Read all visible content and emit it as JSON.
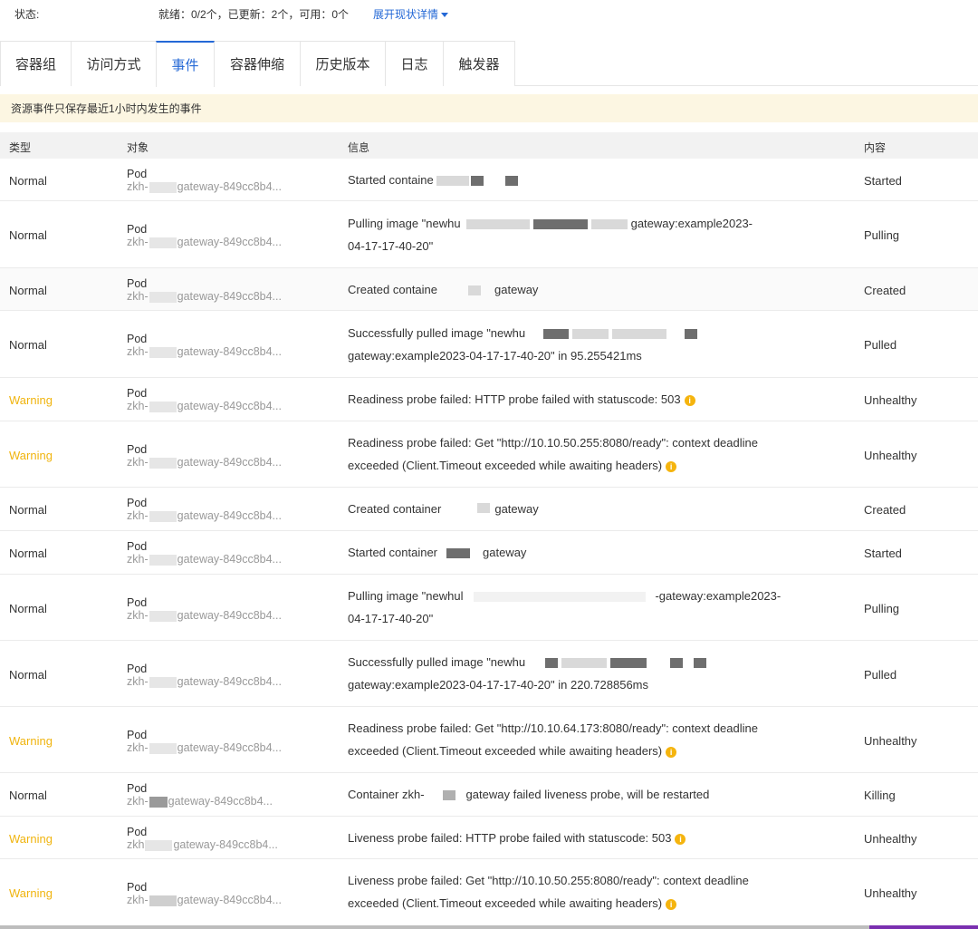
{
  "status": {
    "label": "状态:",
    "value": "就绪：0/2个，已更新：2个，可用：0个",
    "link": "展开现状详情"
  },
  "tabs": [
    {
      "label": "容器组",
      "active": false
    },
    {
      "label": "访问方式",
      "active": false
    },
    {
      "label": "事件",
      "active": true
    },
    {
      "label": "容器伸缩",
      "active": false
    },
    {
      "label": "历史版本",
      "active": false
    },
    {
      "label": "日志",
      "active": false
    },
    {
      "label": "触发器",
      "active": false
    }
  ],
  "notice": "资源事件只保存最近1小时内发生的事件",
  "table": {
    "headers": {
      "type": "类型",
      "object": "对象",
      "message": "信息",
      "reason": "内容"
    },
    "rows": [
      {
        "type": "Normal",
        "kind": "Pod",
        "name_prefix": "zkh-",
        "name_suffix": "gateway-849cc8b4...",
        "msg1": "Started containe",
        "msg2": "",
        "reason": "Started"
      },
      {
        "type": "Normal",
        "kind": "Pod",
        "name_prefix": "zkh-",
        "name_suffix": "gateway-849cc8b4...",
        "msg1": "Pulling image \"newhu",
        "msg1b": "gateway:example2023-",
        "msg2": "04-17-17-40-20\"",
        "reason": "Pulling"
      },
      {
        "type": "Normal",
        "kind": "Pod",
        "name_prefix": "zkh-",
        "name_suffix": "gateway-849cc8b4...",
        "msg1": "Created containe",
        "msg1b": "gateway",
        "msg2": "",
        "reason": "Created"
      },
      {
        "type": "Normal",
        "kind": "Pod",
        "name_prefix": "zkh-",
        "name_suffix": "gateway-849cc8b4...",
        "msg1": "Successfully pulled image \"newhu",
        "msg2": "gateway:example2023-04-17-17-40-20\" in 95.255421ms",
        "reason": "Pulled"
      },
      {
        "type": "Warning",
        "kind": "Pod",
        "name_prefix": "zkh-",
        "name_suffix": "gateway-849cc8b4...",
        "msg1": "Readiness probe failed: HTTP probe failed with statuscode: 503",
        "msg2": "",
        "reason": "Unhealthy",
        "icon": true
      },
      {
        "type": "Warning",
        "kind": "Pod",
        "name_prefix": "zkh-",
        "name_suffix": "gateway-849cc8b4...",
        "msg1": "Readiness probe failed: Get \"http://10.10.50.255:8080/ready\": context deadline",
        "msg2": "exceeded (Client.Timeout exceeded while awaiting headers)",
        "reason": "Unhealthy",
        "icon2": true
      },
      {
        "type": "Normal",
        "kind": "Pod",
        "name_prefix": "zkh-",
        "name_suffix": "gateway-849cc8b4...",
        "msg1": "Created container",
        "msg1b": "gateway",
        "msg2": "",
        "reason": "Created"
      },
      {
        "type": "Normal",
        "kind": "Pod",
        "name_prefix": "zkh-",
        "name_suffix": "gateway-849cc8b4...",
        "msg1": "Started container",
        "msg1b": "gateway",
        "msg2": "",
        "reason": "Started"
      },
      {
        "type": "Normal",
        "kind": "Pod",
        "name_prefix": "zkh-",
        "name_suffix": "gateway-849cc8b4...",
        "msg1": "Pulling image \"newhul",
        "msg1b": "-gateway:example2023-",
        "msg2": "04-17-17-40-20\"",
        "reason": "Pulling"
      },
      {
        "type": "Normal",
        "kind": "Pod",
        "name_prefix": "zkh-",
        "name_suffix": "gateway-849cc8b4...",
        "msg1": "Successfully pulled image \"newhu",
        "msg2": "gateway:example2023-04-17-17-40-20\" in 220.728856ms",
        "reason": "Pulled"
      },
      {
        "type": "Warning",
        "kind": "Pod",
        "name_prefix": "zkh-",
        "name_suffix": "gateway-849cc8b4...",
        "msg1": "Readiness probe failed: Get \"http://10.10.64.173:8080/ready\": context deadline",
        "msg2": "exceeded (Client.Timeout exceeded while awaiting headers)",
        "reason": "Unhealthy",
        "icon2": true
      },
      {
        "type": "Normal",
        "kind": "Pod",
        "name_prefix": "zkh-",
        "name_suffix": "gateway-849cc8b4...",
        "msg1": "Container zkh-",
        "msg1b": "gateway failed liveness probe, will be restarted",
        "msg2": "",
        "reason": "Killing"
      },
      {
        "type": "Warning",
        "kind": "Pod",
        "name_prefix": "zkh",
        "name_suffix": "gateway-849cc8b4...",
        "msg1": "Liveness probe failed: HTTP probe failed with statuscode: 503",
        "msg2": "",
        "reason": "Unhealthy",
        "icon": true
      },
      {
        "type": "Warning",
        "kind": "Pod",
        "name_prefix": "zkh-",
        "name_suffix": "gateway-849cc8b4...",
        "msg1": "Liveness probe failed: Get \"http://10.10.50.255:8080/ready\": context deadline",
        "msg2": "exceeded (Client.Timeout exceeded while awaiting headers)",
        "reason": "Unhealthy",
        "icon2": true
      }
    ]
  },
  "colors": {
    "accent": "#2468d6",
    "warning": "#f0b40e",
    "notice_bg": "#fcf6e2",
    "header_bg": "#f2f2f2"
  },
  "icons": {
    "status_link": "chevron-down-icon",
    "warning_info": "info-icon"
  }
}
